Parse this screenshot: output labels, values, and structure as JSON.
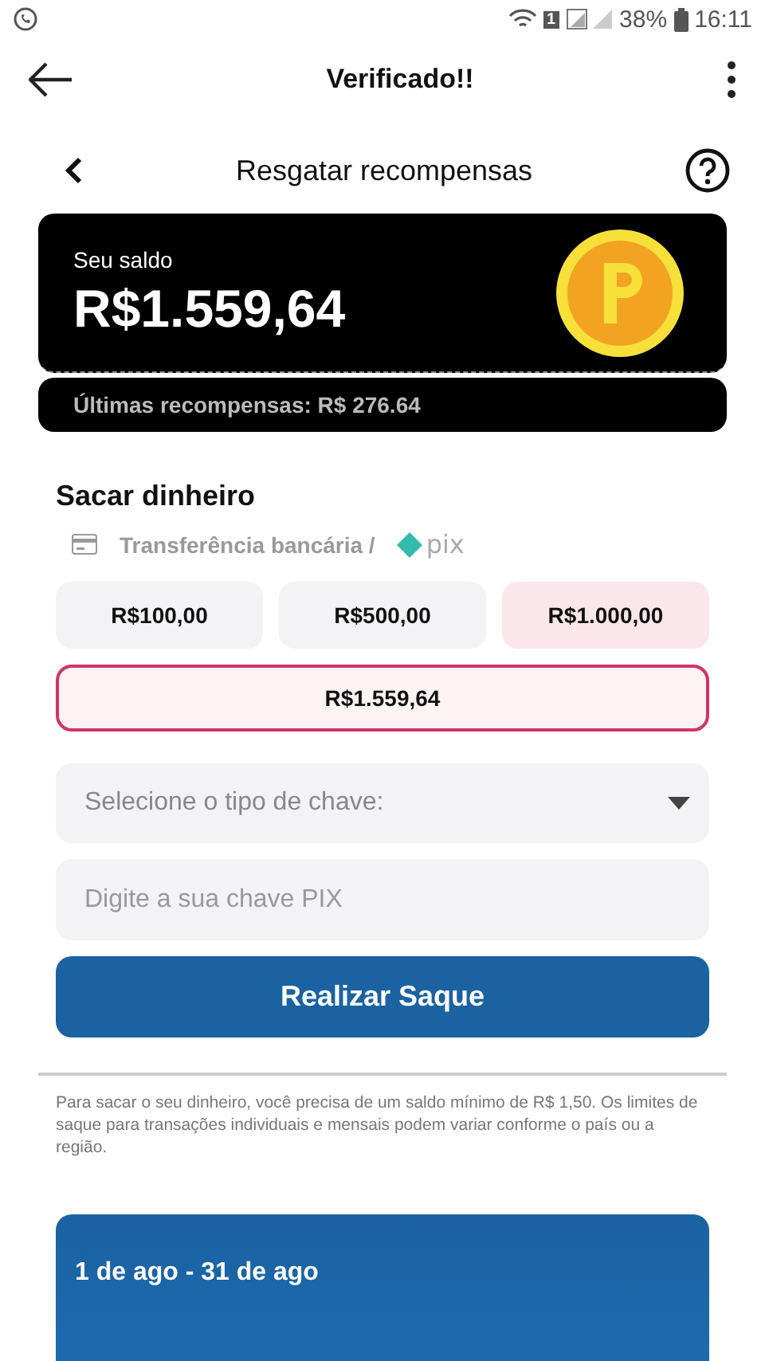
{
  "status_bar": {
    "sim": "1",
    "battery": "38%",
    "time": "16:11"
  },
  "app_bar": {
    "title": "Verificado!!"
  },
  "header": {
    "title": "Resgatar recompensas"
  },
  "balance": {
    "label": "Seu saldo",
    "amount": "R$1.559,64",
    "recent": "Últimas recompensas: R$ 276.64"
  },
  "withdraw": {
    "title": "Sacar dinheiro",
    "method": "Transferência bancária /",
    "method_logo": "pix",
    "amounts": [
      {
        "label": "R$100,00",
        "selected": false,
        "highlighted": false
      },
      {
        "label": "R$500,00",
        "selected": false,
        "highlighted": false
      },
      {
        "label": "R$1.000,00",
        "selected": false,
        "highlighted": true
      },
      {
        "label": "R$1.559,64",
        "selected": true,
        "highlighted": false
      }
    ],
    "key_type": {
      "placeholder": "Selecione o tipo de chave:"
    },
    "key": {
      "placeholder": "Digite a sua chave PIX"
    },
    "submit": "Realizar Saque",
    "note": "Para sacar o seu dinheiro, você precisa de um saldo mínimo de R$ 1,50. Os limites de saque para transações individuais e mensais podem variar conforme o país ou a região."
  },
  "period_card": {
    "title": "1 de ago - 31 de ago"
  }
}
